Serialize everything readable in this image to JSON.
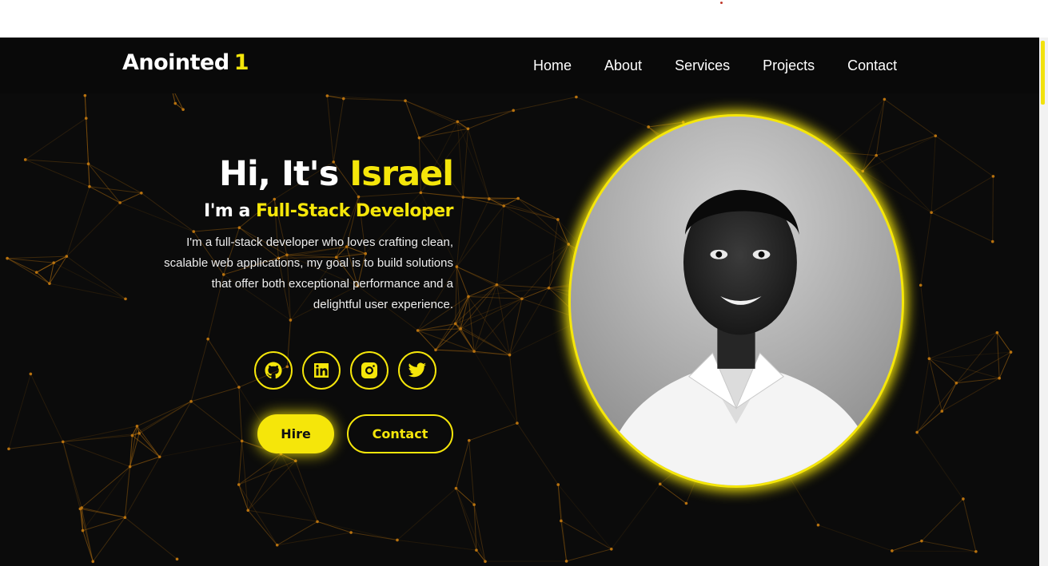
{
  "brand": {
    "name": "Anointed",
    "accent": "1"
  },
  "nav": {
    "items": [
      "Home",
      "About",
      "Services",
      "Projects",
      "Contact"
    ]
  },
  "hero": {
    "greeting": "Hi, It's ",
    "name": "Israel",
    "role_prefix": "I'm a ",
    "role": "Full-Stack Developer",
    "description_lines": [
      "I'm a full-stack developer who loves crafting clean,",
      "scalable web applications, my goal is to build solutions",
      "that offer both exceptional performance and a",
      "delightful user experience."
    ],
    "socials": [
      "github-icon",
      "linkedin-icon",
      "instagram-icon",
      "twitter-icon"
    ],
    "buttons": {
      "hire": "Hire",
      "contact": "Contact"
    }
  },
  "colors": {
    "accent": "#f5e60a",
    "background": "#0b0b0b",
    "network": "#b8720f"
  }
}
